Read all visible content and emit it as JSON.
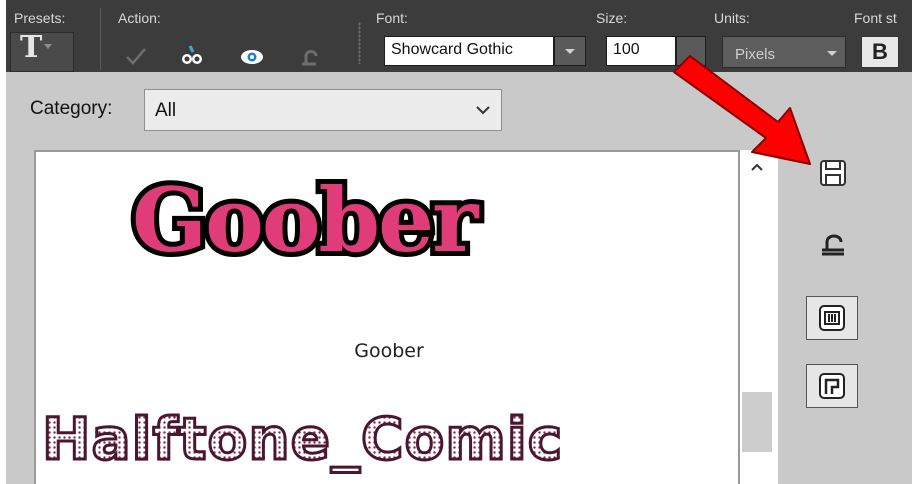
{
  "toolbar": {
    "presets_label": "Presets:",
    "action_label": "Action:",
    "font_label": "Font:",
    "font_value": "Showcard Gothic",
    "size_label": "Size:",
    "size_value": "100",
    "units_label": "Units:",
    "units_value": "Pixels",
    "font_style_label": "Font st",
    "bold_label": "B"
  },
  "panel": {
    "category_label": "Category:",
    "category_value": "All"
  },
  "samples": [
    {
      "art": "Goober",
      "caption": "Goober"
    },
    {
      "art": "Halftone_Comic",
      "caption": ""
    }
  ],
  "colors": {
    "toolbar_bg": "#3c3c3c",
    "goober_fill": "#e03c79",
    "halftone_stroke": "#4a1630",
    "arrow": "#ff0000"
  },
  "icons": [
    "text-tool-icon",
    "checkmark-icon",
    "wand-icon",
    "eye-icon",
    "undo-icon",
    "save-icon",
    "revert-icon",
    "preset-a-icon",
    "preset-b-icon",
    "red-arrow-annotation",
    "scroll-up-icon"
  ]
}
